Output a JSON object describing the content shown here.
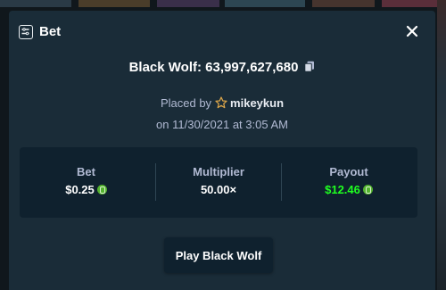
{
  "modal": {
    "title": "Bet",
    "close_label": "×"
  },
  "bet": {
    "game": "Black Wolf",
    "bet_id": "63,997,627,680",
    "game_line": "Black Wolf: 63,997,627,680",
    "placed_by_label": "Placed by",
    "username": "mikeykun",
    "date_line": "on 11/30/2021 at 3:05 AM"
  },
  "stats": [
    {
      "label": "Bet",
      "value": "$0.25",
      "currency_icon": "coin-icon"
    },
    {
      "label": "Multiplier",
      "value": "50.00×"
    },
    {
      "label": "Payout",
      "value": "$12.46",
      "currency_icon": "coin-icon"
    }
  ],
  "actions": {
    "play_label": "Play Black Wolf"
  },
  "colors": {
    "modal_bg": "#1a2c38",
    "stats_bg": "#0f212e",
    "label": "#b1bad3",
    "payout": "#1fff20",
    "coin": "#54b32f"
  }
}
